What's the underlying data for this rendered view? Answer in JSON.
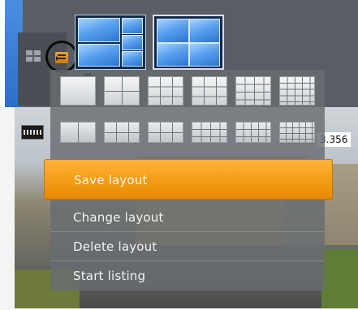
{
  "camera": {
    "info_text": "3.356"
  },
  "layouts": {
    "saved": [
      {
        "id": "layout-1",
        "selected": false
      },
      {
        "id": "layout-2",
        "selected": true
      }
    ]
  },
  "layout_grid_row1": [
    {
      "icon": "grid-1x1-icon"
    },
    {
      "icon": "grid-2x2-icon"
    },
    {
      "icon": "grid-1plus5-icon"
    },
    {
      "icon": "grid-3x3-icon"
    },
    {
      "icon": "grid-4x4-icon"
    },
    {
      "icon": "grid-5x5-icon"
    }
  ],
  "layout_grid_row2": [
    {
      "icon": "grid-wide-1plus2-icon"
    },
    {
      "icon": "grid-wide-2x3-icon"
    },
    {
      "icon": "grid-wide-3x2-icon"
    },
    {
      "icon": "grid-wide-4x3-icon"
    },
    {
      "icon": "grid-wide-5x3-icon"
    },
    {
      "icon": "grid-wide-6x4-icon"
    }
  ],
  "menu": {
    "save_layout": "Save layout",
    "change_layout": "Change layout",
    "delete_layout": "Delete layout",
    "start_listing": "Start listing"
  },
  "colors": {
    "highlight": "#f29a12",
    "panel": "#686c72",
    "thumb_blue": "#5aa1ef"
  }
}
